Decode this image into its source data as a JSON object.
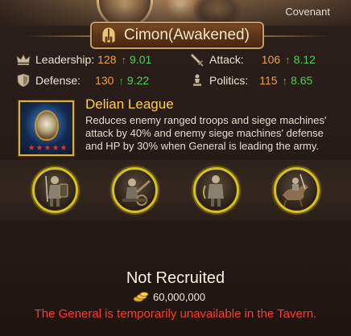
{
  "header": {
    "faction_label": "Covenant"
  },
  "general": {
    "name": "Cimon(Awakened)",
    "icon": "helmet-icon"
  },
  "stats": [
    {
      "label": "Leadership:",
      "value": "128",
      "increase": "9.01",
      "icon": "crown-icon"
    },
    {
      "label": "Attack:",
      "value": "106",
      "increase": "8.12",
      "icon": "sword-icon"
    },
    {
      "label": "Defense:",
      "value": "130",
      "increase": "9.22",
      "icon": "shield-icon"
    },
    {
      "label": "Politics:",
      "value": "115",
      "increase": "8.65",
      "icon": "chess-piece-icon"
    }
  ],
  "skill": {
    "title": "Delian League",
    "description": "Reduces enemy ranged troops and siege machines' attack by 40% and enemy siege machines' defense and HP by 30% when General is leading the army.",
    "stars": 5,
    "icon": "delian-league-skill-icon"
  },
  "troops": [
    {
      "icon": "infantry-troop-icon"
    },
    {
      "icon": "siege-troop-icon"
    },
    {
      "icon": "archer-troop-icon"
    },
    {
      "icon": "cavalry-troop-icon"
    }
  ],
  "recruit": {
    "status": "Not Recruited",
    "cost": "60,000,000",
    "cost_icon": "gold-coin-icon",
    "warning": "The General is temporarily unavailable in the Tavern."
  },
  "colors": {
    "stat_value": "#f0a040",
    "stat_increase": "#50d050",
    "skill_title": "#ffd040",
    "warning": "#ff3a28",
    "troop_ring": "#d8c020"
  }
}
